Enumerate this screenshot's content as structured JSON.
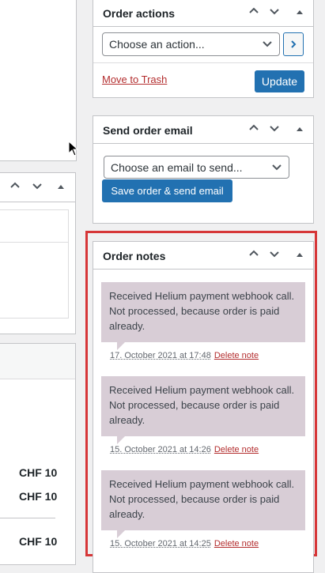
{
  "order_actions": {
    "title": "Order actions",
    "select_value": "Choose an action...",
    "apply_icon": "chevron-right-icon",
    "trash_link": "Move to Trash",
    "update_button": "Update"
  },
  "send_email": {
    "title": "Send order email",
    "select_value": "Choose an email to send...",
    "button": "Save order & send email"
  },
  "order_notes": {
    "title": "Order notes",
    "delete_label": "Delete note",
    "notes": [
      {
        "text": "Received Helium payment webhook call. Not processed, because order is paid already.",
        "date": "17. October 2021 at 17:48"
      },
      {
        "text": "Received Helium payment webhook call. Not processed, because order is paid already.",
        "date": "15. October 2021 at 14:26"
      },
      {
        "text": "Received Helium payment webhook call. Not processed, because order is paid already.",
        "date": "15. October 2021 at 14:25"
      }
    ]
  },
  "left_panel": {
    "prices": [
      "CHF 10",
      "CHF 10",
      "CHF 10"
    ]
  },
  "colors": {
    "primary_button": "#2271b1",
    "note_background": "#d8cdd6",
    "delete_link": "#b32d2e",
    "highlight_border": "#d63638"
  }
}
